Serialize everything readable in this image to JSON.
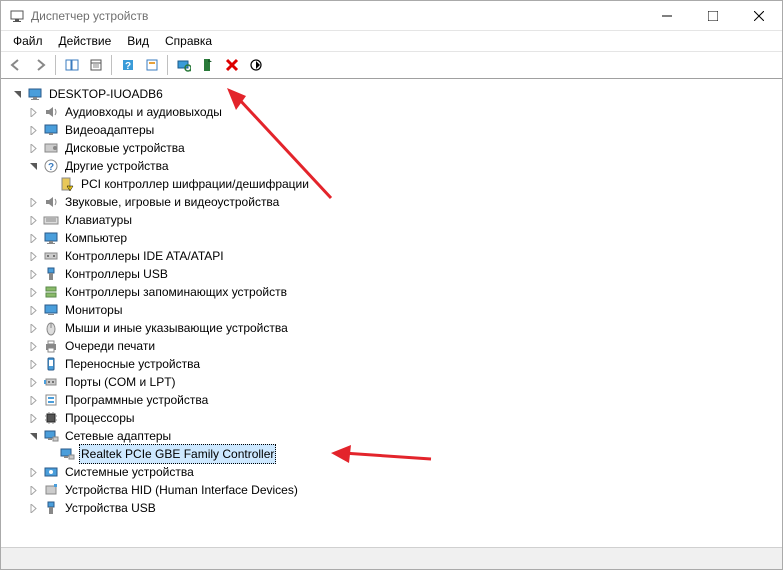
{
  "window": {
    "title": "Диспетчер устройств"
  },
  "menu": {
    "file": "Файл",
    "action": "Действие",
    "view": "Вид",
    "help": "Справка"
  },
  "root": "DESKTOP-IUOADB6",
  "nodes": [
    {
      "label": "Аудиовходы и аудиовыходы",
      "exp": false,
      "icon": "audio"
    },
    {
      "label": "Видеоадаптеры",
      "exp": false,
      "icon": "display"
    },
    {
      "label": "Дисковые устройства",
      "exp": false,
      "icon": "disk"
    },
    {
      "label": "Другие устройства",
      "exp": true,
      "icon": "unknown",
      "children": [
        {
          "label": "PCI контроллер шифрации/дешифрации",
          "icon": "warn"
        }
      ]
    },
    {
      "label": "Звуковые, игровые и видеоустройства",
      "exp": false,
      "icon": "audio"
    },
    {
      "label": "Клавиатуры",
      "exp": false,
      "icon": "keyboard"
    },
    {
      "label": "Компьютер",
      "exp": false,
      "icon": "computer"
    },
    {
      "label": "Контроллеры IDE ATA/ATAPI",
      "exp": false,
      "icon": "ide"
    },
    {
      "label": "Контроллеры USB",
      "exp": false,
      "icon": "usb"
    },
    {
      "label": "Контроллеры запоминающих устройств",
      "exp": false,
      "icon": "storage"
    },
    {
      "label": "Мониторы",
      "exp": false,
      "icon": "monitor"
    },
    {
      "label": "Мыши и иные указывающие устройства",
      "exp": false,
      "icon": "mouse"
    },
    {
      "label": "Очереди печати",
      "exp": false,
      "icon": "printer"
    },
    {
      "label": "Переносные устройства",
      "exp": false,
      "icon": "portable"
    },
    {
      "label": "Порты (COM и LPT)",
      "exp": false,
      "icon": "port"
    },
    {
      "label": "Программные устройства",
      "exp": false,
      "icon": "software"
    },
    {
      "label": "Процессоры",
      "exp": false,
      "icon": "cpu"
    },
    {
      "label": "Сетевые адаптеры",
      "exp": true,
      "icon": "network",
      "children": [
        {
          "label": "Realtek PCIe GBE Family Controller",
          "icon": "network",
          "selected": true
        }
      ]
    },
    {
      "label": "Системные устройства",
      "exp": false,
      "icon": "system"
    },
    {
      "label": "Устройства HID (Human Interface Devices)",
      "exp": false,
      "icon": "hid"
    },
    {
      "label": "Устройства USB",
      "exp": false,
      "icon": "usb"
    }
  ]
}
